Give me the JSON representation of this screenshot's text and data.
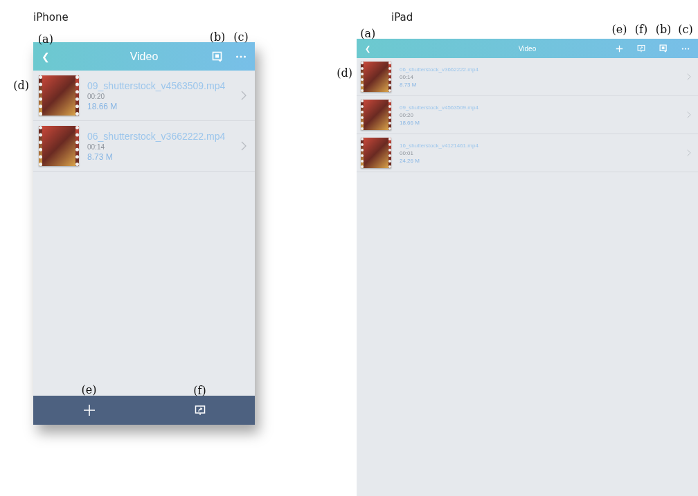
{
  "iphone": {
    "device_label": "iPhone",
    "nav": {
      "title": "Video",
      "back": {
        "glyph": "❮",
        "callout": "(a)"
      },
      "actions": [
        {
          "kind": "share",
          "callout": "(b)"
        },
        {
          "kind": "more",
          "callout": "(c)"
        }
      ]
    },
    "list_callout": "(d)",
    "videos": [
      {
        "name": "09_shutterstock_v4563509.mp4",
        "duration": "00:20",
        "size": "18.66 M"
      },
      {
        "name": "06_shutterstock_v3662222.mp4",
        "duration": "00:14",
        "size": "8.73 M"
      }
    ],
    "toolbar": [
      {
        "kind": "add",
        "callout": "(e)"
      },
      {
        "kind": "airplay",
        "callout": "(f)"
      }
    ]
  },
  "ipad": {
    "device_label": "iPad",
    "nav": {
      "title": "Video",
      "back": {
        "glyph": "❮",
        "callout": "(a)"
      },
      "actions": [
        {
          "kind": "add",
          "callout": "(e)"
        },
        {
          "kind": "airplay",
          "callout": "(f)"
        },
        {
          "kind": "share",
          "callout": "(b)"
        },
        {
          "kind": "more",
          "callout": "(c)"
        }
      ]
    },
    "list_callout": "(d)",
    "videos": [
      {
        "name": "06_shutterstock_v3662222.mp4",
        "duration": "00:14",
        "size": "8.73 M"
      },
      {
        "name": "09_shutterstock_v4563509.mp4",
        "duration": "00:20",
        "size": "18.66 M"
      },
      {
        "name": "16_shutterstock_v4121461.mp4",
        "duration": "00:01",
        "size": "24.26 M"
      }
    ]
  }
}
